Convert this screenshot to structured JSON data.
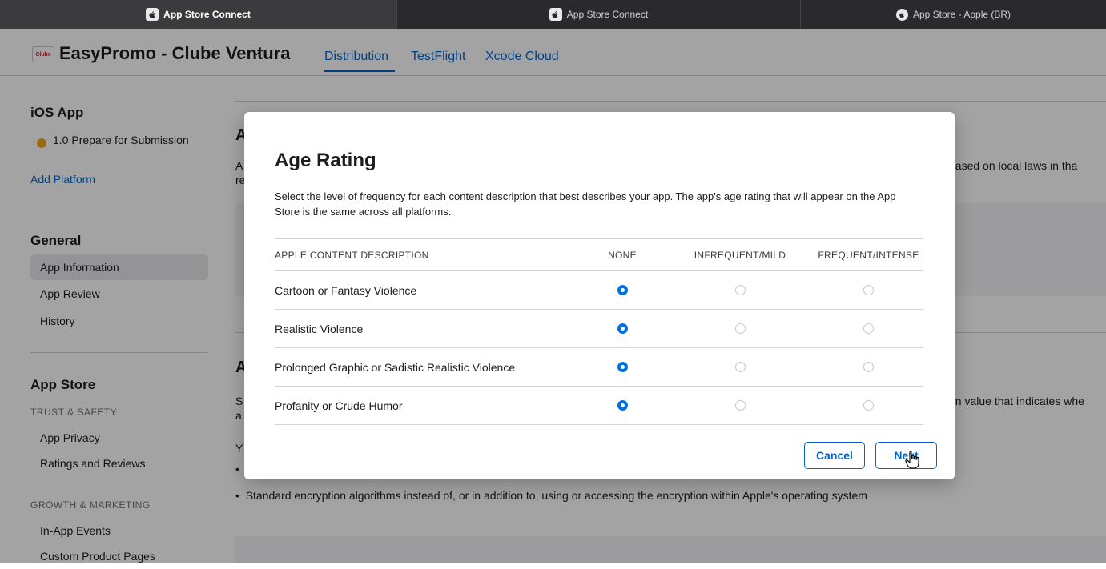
{
  "browser_tabs": [
    {
      "label": "App Store Connect",
      "icon": "apple-icon",
      "active": true
    },
    {
      "label": "App Store Connect",
      "icon": "apple-icon",
      "active": false
    },
    {
      "label": "App Store - Apple (BR)",
      "icon": "apple-circle-icon",
      "active": false
    }
  ],
  "header": {
    "app_icon_text": "Clube",
    "app_name": "EasyPromo - Clube Ventura",
    "tabs": [
      "Distribution",
      "TestFlight",
      "Xcode Cloud"
    ],
    "active_tab": "Distribution"
  },
  "sidebar": {
    "platform_heading": "iOS App",
    "version_status": "1.0 Prepare for Submission",
    "add_platform": "Add Platform",
    "general_heading": "General",
    "general_items": [
      "App Information",
      "App Review",
      "History"
    ],
    "selected_item": "App Information",
    "app_store_heading": "App Store",
    "trust_safety_label": "TRUST & SAFETY",
    "trust_items": [
      "App Privacy",
      "Ratings and Reviews"
    ],
    "growth_label": "GROWTH & MARKETING",
    "growth_items": [
      "In-App Events",
      "Custom Product Pages"
    ]
  },
  "background": {
    "section1_heading_fragment": "A",
    "section1_line1_left": "A",
    "section1_line2_left": "re",
    "section1_line1_right": "based on local laws in tha",
    "section2_heading_fragment": "A",
    "section2_line1_left": "S",
    "section2_line2_left": "a",
    "section2_line1_right": "an value that indicates whe",
    "section2_line3_left": "Y",
    "bullet_left": "•",
    "bullet_text": "Standard encryption algorithms instead of, or in addition to, using or accessing the encryption within Apple's operating system"
  },
  "modal": {
    "title": "Age Rating",
    "description": "Select the level of frequency for each content description that best describes your app. The app's age rating that will appear on the App Store is the same across all platforms.",
    "columns": [
      "APPLE CONTENT DESCRIPTION",
      "NONE",
      "INFREQUENT/MILD",
      "FREQUENT/INTENSE"
    ],
    "rows": [
      {
        "label": "Cartoon or Fantasy Violence",
        "selected": "NONE"
      },
      {
        "label": "Realistic Violence",
        "selected": "NONE"
      },
      {
        "label": "Prolonged Graphic or Sadistic Realistic Violence",
        "selected": "NONE"
      },
      {
        "label": "Profanity or Crude Humor",
        "selected": "NONE"
      }
    ],
    "cancel_label": "Cancel",
    "next_label": "Next"
  },
  "colors": {
    "accent": "#0066cc",
    "radio_selected": "#0071e3",
    "status_dot": "#f5a623",
    "overlay": "rgba(0,0,0,0.36)"
  }
}
